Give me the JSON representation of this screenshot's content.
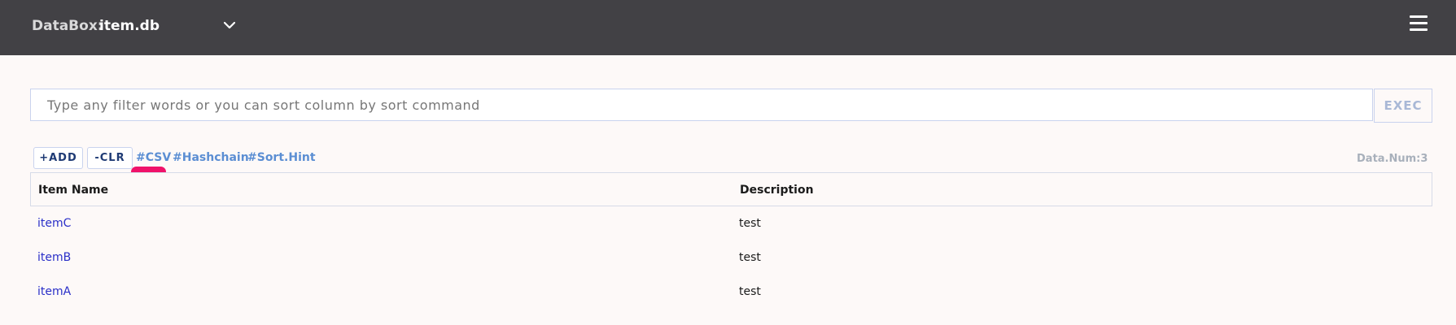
{
  "header": {
    "brand": "DataBox:",
    "db_name": "item.db",
    "dropdown_icon": "chevron-down-icon",
    "menu_icon": "hamburger-menu-icon"
  },
  "filter": {
    "placeholder": "Type any filter words or you can sort column by sort command",
    "value": "",
    "exec_label": "EXEC"
  },
  "toolbar": {
    "add_label": "+ADD",
    "clr_label": "-CLR",
    "tags": [
      "#CSV",
      "#Hashchain",
      "#Sort.Hint"
    ],
    "data_num": "Data.Num:3"
  },
  "table": {
    "columns": [
      "Item Name",
      "Description"
    ],
    "rows": [
      {
        "name": "itemC",
        "description": "test"
      },
      {
        "name": "itemB",
        "description": "test"
      },
      {
        "name": "itemA",
        "description": "test"
      }
    ]
  },
  "colors": {
    "topbar": "#424145",
    "background": "#fdf9f8",
    "link": "#2a2fc8",
    "tag": "#5b8ed3",
    "highlight": "#f0126a"
  }
}
